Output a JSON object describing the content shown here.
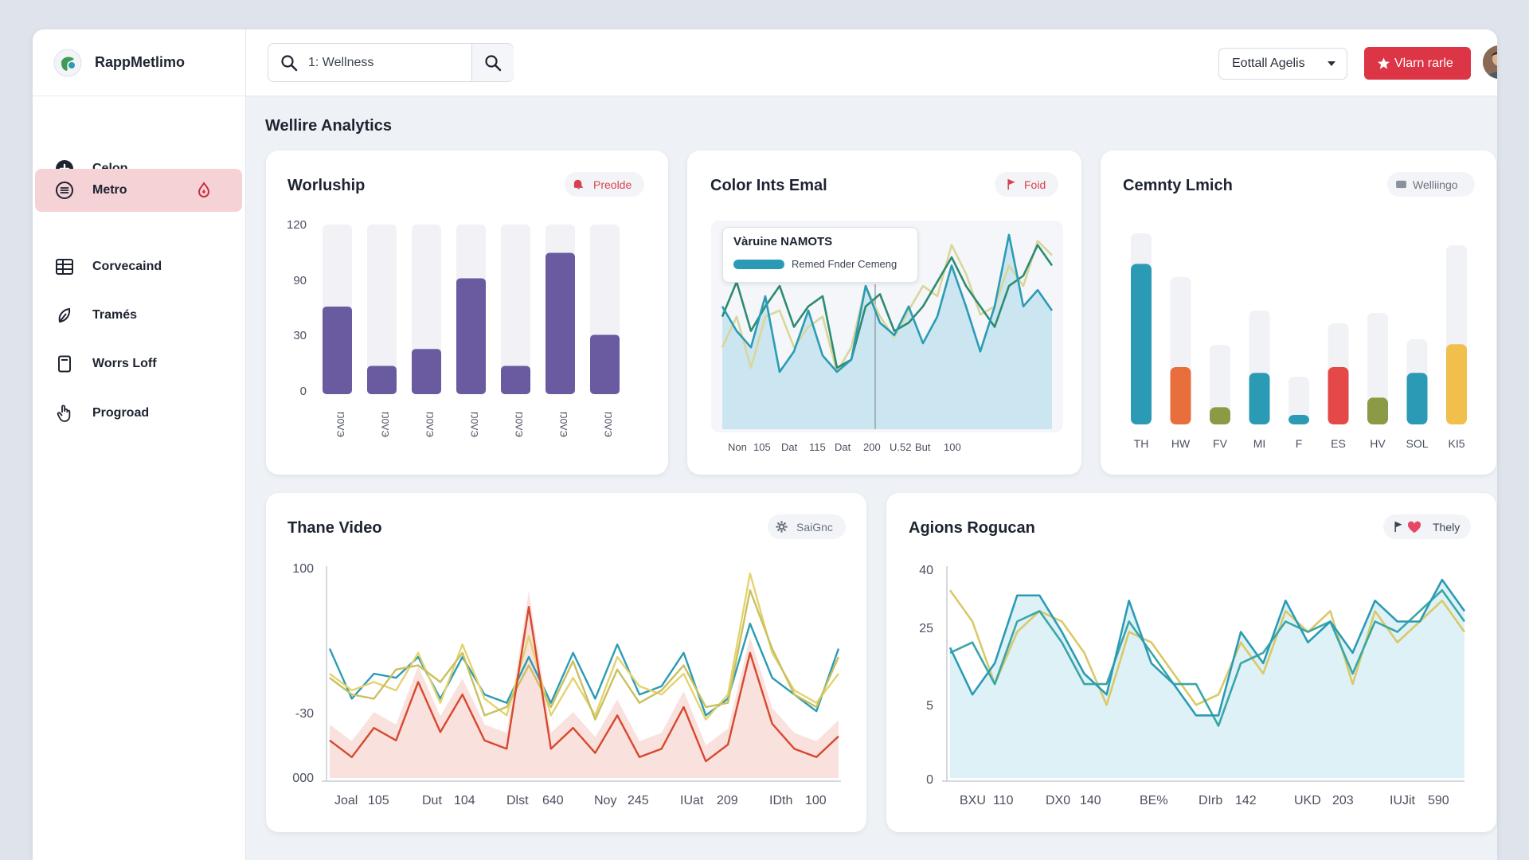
{
  "app": {
    "name": "RappMetlimo"
  },
  "sidebar": {
    "items": [
      {
        "label": "Celop",
        "icon": "plus-circle-icon",
        "active": false
      },
      {
        "label": "Metro",
        "icon": "list-circle-icon",
        "active": true
      },
      {
        "label": "Corvecaind",
        "icon": "table-icon",
        "active": false
      },
      {
        "label": "Tramés",
        "icon": "leaf-icon",
        "active": false
      },
      {
        "label": "Worrs Loff",
        "icon": "document-icon",
        "active": false
      },
      {
        "label": "Progroad",
        "icon": "hand-pointer-icon",
        "active": false
      }
    ]
  },
  "header": {
    "search_value": "1: Wellness",
    "select_label": "Eottall Agelis",
    "cta_label": "Vlarn rarle"
  },
  "page": {
    "title": "Wellire Analytics"
  },
  "cards": {
    "worship": {
      "title": "Worluship",
      "chip": "Preolde"
    },
    "color": {
      "title": "Color Ints Emal",
      "chip": "Foid",
      "tooltip_title": "Vàruine NAMOTS",
      "tooltip_item": "Remed Fnder Cemeng"
    },
    "cemnty": {
      "title": "Cemnty Lmich",
      "chip": "Welliingo"
    },
    "thane": {
      "title": "Thane Video",
      "chip": "SaiGnc"
    },
    "agions": {
      "title": "Agions Rogucan",
      "chip": "Thely"
    }
  },
  "colors": {
    "purple": "#6a5aa0",
    "teal": "#2b9bb5",
    "orange": "#e86f3b",
    "olive": "#8a9a45",
    "red": "#e54848",
    "yellow": "#f0bf4c",
    "accent": "#dc3545"
  },
  "chart_data": [
    {
      "id": "worship",
      "type": "bar",
      "categories": [
        "Ŋ0VЭ",
        "Ŋ0VЭ",
        "Ŋ0VЭ",
        "Ŋ0VЭ",
        "Ŋ0VЭ",
        "Ŋ0VЭ",
        "Ŋ0VЭ"
      ],
      "values": [
        62,
        20,
        32,
        82,
        20,
        100,
        42
      ],
      "yticks": [
        "120",
        "90",
        "30",
        "0"
      ],
      "ylim": [
        0,
        120
      ]
    },
    {
      "id": "color",
      "type": "area",
      "xticks": [
        "Non",
        "105",
        "Dat",
        "115",
        "Dat",
        "200",
        "U.52",
        "But",
        "100"
      ],
      "series": [
        {
          "color": "#2b9bb5",
          "values": [
            60,
            48,
            40,
            65,
            28,
            38,
            58,
            36,
            28,
            34,
            70,
            52,
            46,
            60,
            42,
            55,
            80,
            60,
            38,
            60,
            95,
            60,
            68,
            58
          ]
        },
        {
          "color": "#2e8b6f",
          "values": [
            55,
            72,
            48,
            60,
            70,
            50,
            60,
            65,
            30,
            34,
            60,
            66,
            48,
            52,
            60,
            72,
            84,
            70,
            60,
            50,
            70,
            75,
            90,
            80
          ]
        },
        {
          "color": "#d8d69a",
          "values": [
            40,
            55,
            30,
            55,
            58,
            40,
            50,
            55,
            28,
            40,
            70,
            55,
            45,
            58,
            70,
            65,
            90,
            76,
            56,
            60,
            80,
            70,
            92,
            85
          ]
        }
      ]
    },
    {
      "id": "cemnty",
      "type": "bar",
      "categories": [
        "TH",
        "HW",
        "FV",
        "MI",
        "F",
        "ES",
        "HV",
        "SOL",
        "KI5"
      ],
      "values": [
        84,
        30,
        9,
        27,
        5,
        30,
        14,
        27,
        42
      ],
      "series_colors": [
        "#2b9bb5",
        "#e86f3b",
        "#8a9a45",
        "#2b9bb5",
        "#2b9bb5",
        "#e54848",
        "#8a9a45",
        "#2b9bb5",
        "#f0bf4c"
      ]
    },
    {
      "id": "thane",
      "type": "line",
      "yticks": [
        "100",
        "-30",
        "000"
      ],
      "xticks": [
        "Joal",
        "105",
        "Dut",
        "104",
        "Dlst",
        "640",
        "Noy",
        "245",
        "IUat",
        "209",
        "IDth",
        "100"
      ],
      "series": [
        {
          "color": "#2b9bb5",
          "values": [
            62,
            38,
            50,
            48,
            58,
            38,
            58,
            40,
            36,
            58,
            36,
            60,
            38,
            64,
            40,
            44,
            60,
            30,
            38,
            74,
            48,
            40,
            32,
            62
          ]
        },
        {
          "color": "#e4d36e",
          "values": [
            50,
            42,
            46,
            42,
            60,
            36,
            64,
            38,
            30,
            68,
            30,
            48,
            30,
            58,
            44,
            40,
            50,
            28,
            40,
            98,
            60,
            42,
            36,
            50
          ]
        },
        {
          "color": "#c9c060",
          "values": [
            48,
            40,
            38,
            52,
            54,
            46,
            60,
            30,
            34,
            54,
            34,
            56,
            28,
            52,
            36,
            42,
            54,
            34,
            36,
            90,
            62,
            40,
            34,
            58
          ]
        },
        {
          "color": "#d7482f",
          "values": [
            18,
            10,
            24,
            18,
            46,
            22,
            40,
            18,
            14,
            82,
            14,
            24,
            12,
            30,
            10,
            14,
            34,
            8,
            16,
            60,
            26,
            14,
            10,
            20
          ]
        }
      ]
    },
    {
      "id": "agions",
      "type": "line",
      "yticks": [
        "40",
        "25",
        "5",
        "0"
      ],
      "xticks": [
        "BXU",
        "110",
        "DX0",
        "140",
        "BE%",
        "DIrb",
        "142",
        "UKD",
        "203",
        "IUJit",
        "590"
      ],
      "series": [
        {
          "color": "#2b9bb5",
          "values": [
            25,
            16,
            22,
            35,
            35,
            28,
            20,
            16,
            34,
            22,
            18,
            12,
            12,
            28,
            22,
            34,
            26,
            30,
            24,
            34,
            30,
            30,
            38,
            32
          ]
        },
        {
          "color": "#3aa6a6",
          "values": [
            24,
            26,
            18,
            30,
            32,
            26,
            18,
            18,
            30,
            24,
            18,
            18,
            10,
            22,
            24,
            30,
            28,
            30,
            20,
            30,
            28,
            32,
            36,
            30
          ]
        },
        {
          "color": "#d9c968",
          "values": [
            36,
            30,
            18,
            28,
            32,
            30,
            24,
            14,
            28,
            26,
            20,
            14,
            16,
            26,
            20,
            32,
            28,
            32,
            18,
            32,
            26,
            30,
            34,
            28
          ]
        }
      ]
    }
  ]
}
